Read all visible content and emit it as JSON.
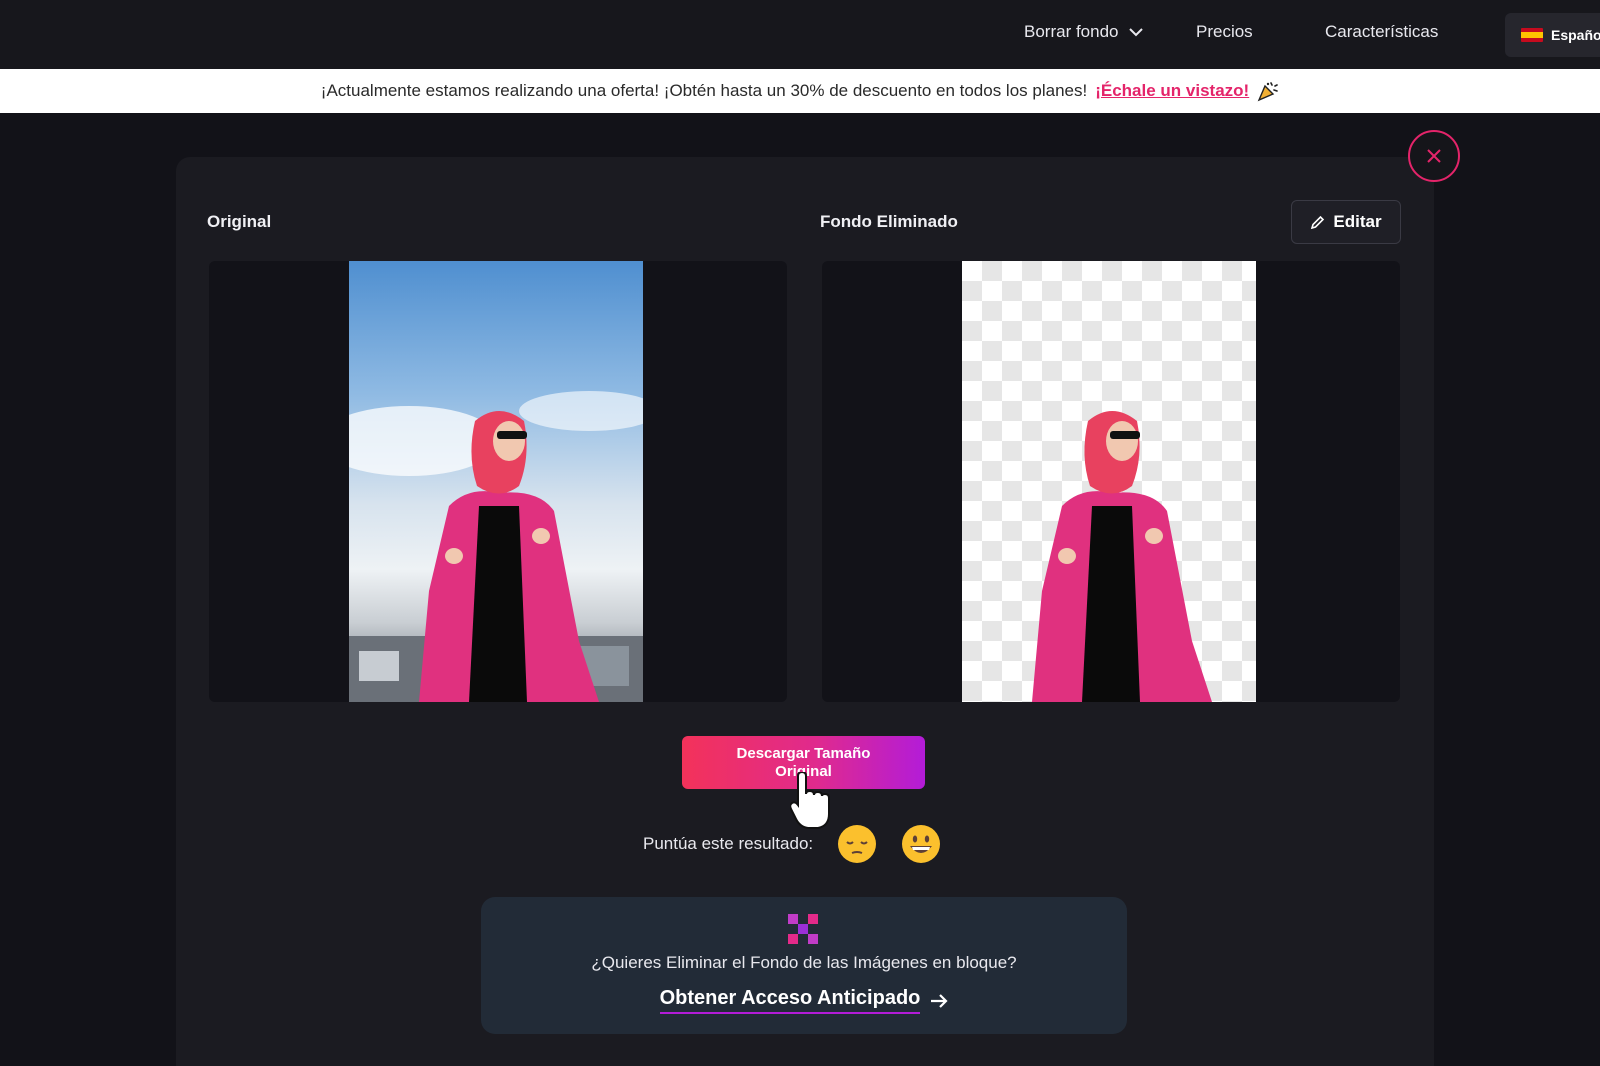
{
  "nav": {
    "items": [
      {
        "label": "Borrar fondo",
        "icon": "chevron-down-icon"
      },
      {
        "label": "Precios"
      },
      {
        "label": "Características"
      }
    ],
    "language": {
      "label": "Españo",
      "icon": "spain-flag-icon"
    }
  },
  "promo": {
    "text": "¡Actualmente estamos realizando una oferta! ¡Obtén hasta un 30% de descuento en todos los planes!",
    "link_label": "¡Échale un vistazo!",
    "icon": "party-popper-icon"
  },
  "result": {
    "close_icon": "close-icon",
    "original_label": "Original",
    "removed_label": "Fondo Eliminado",
    "edit_label": "Editar",
    "edit_icon": "pencil-icon"
  },
  "download": {
    "label": "Descargar Tamaño Original"
  },
  "rating": {
    "label": "Puntúa este resultado:",
    "options": [
      "pensive-face-icon",
      "grinning-face-icon"
    ]
  },
  "bulk": {
    "icon": "grid-icon",
    "question": "¿Quieres Eliminar el Fondo de las Imágenes en bloque?",
    "link_label": "Obtener Acceso Anticipado",
    "link_icon": "arrow-right-icon"
  },
  "colors": {
    "accent": "#e4246a",
    "gradient_start": "#f3325a",
    "gradient_end": "#b31cd8",
    "background": "#121218"
  }
}
